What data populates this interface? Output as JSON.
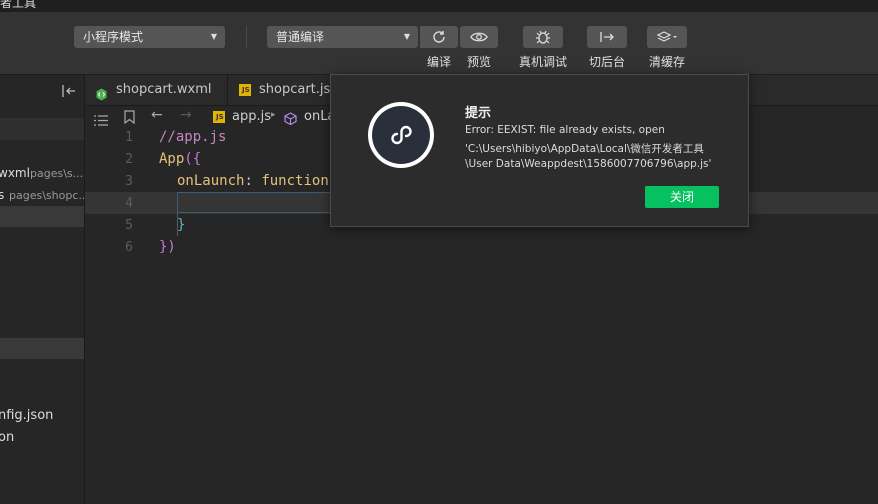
{
  "titlebar": {
    "title": "者工具"
  },
  "toolbar": {
    "mode_select": "小程序模式",
    "compile_select": "普通编译",
    "buttons": {
      "compile": "编译",
      "preview": "预览",
      "remote_debug": "真机调试",
      "background": "切后台",
      "clear_cache": "清缓存"
    }
  },
  "sidebar": {
    "rows": [
      {
        "name": "wxml",
        "path": "pages\\s..."
      },
      {
        "name": "s",
        "path": "pages\\shopc..."
      },
      {
        "name": "nfig.json",
        "path": ""
      },
      {
        "name": "on",
        "path": ""
      }
    ]
  },
  "tabs": [
    {
      "label": "shopcart.wxml",
      "icon": "wxml-file-icon"
    },
    {
      "label": "shopcart.js",
      "icon": "js-file-icon"
    }
  ],
  "breadcrumb": {
    "file": "app.js",
    "symbol": "onLa"
  },
  "editor": {
    "line_numbers": [
      "1",
      "2",
      "3",
      "4",
      "5",
      "6"
    ],
    "code": {
      "l1": "//app.js",
      "l2_name": "App",
      "l2_brace": "({",
      "l3_key": "onLaunch",
      "l3_colon": ":",
      "l3_fn": "function",
      "l5": "}",
      "l6": "})"
    }
  },
  "dialog": {
    "title": "提示",
    "message_lines": [
      "Error: EEXIST: file already exists, open",
      "'C:\\Users\\hibiyo\\AppData\\Local\\微信开发者工具",
      "\\User Data\\Weappdest\\1586007706796\\app.js'"
    ],
    "close_button": "关闭"
  },
  "colors": {
    "accent": "#07c160",
    "code_comment": "#c586c0",
    "code_key": "#e5c07b"
  }
}
